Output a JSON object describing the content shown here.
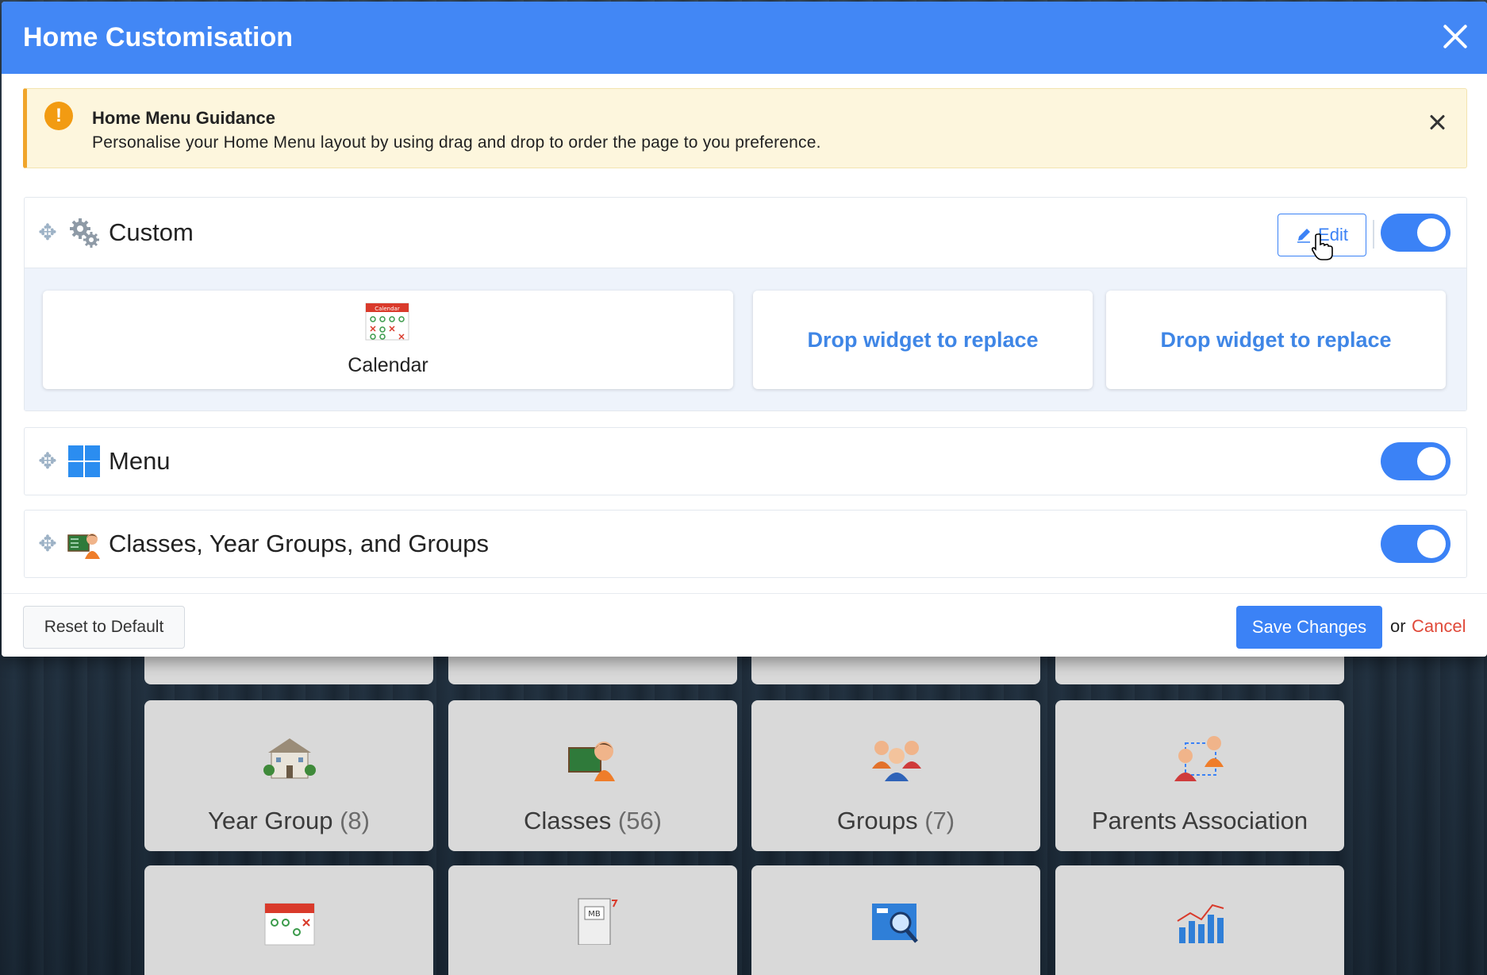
{
  "modal": {
    "title": "Home Customisation",
    "close_icon": "close-icon"
  },
  "alert": {
    "title": "Home Menu Guidance",
    "text": "Personalise your Home Menu layout by using drag and drop to order the page to you preference.",
    "icon": "!",
    "colors": {
      "background": "#fdf6dd",
      "accent": "#f0a52a"
    }
  },
  "sections": {
    "custom": {
      "label": "Custom",
      "icon": "gear-icon",
      "edit_label": "Edit",
      "enabled": true,
      "widgets": {
        "calendar": {
          "label": "Calendar",
          "icon_text": "Calendar"
        },
        "drop1": {
          "label": "Drop widget to replace"
        },
        "drop2": {
          "label": "Drop widget to replace"
        }
      }
    },
    "menu": {
      "label": "Menu",
      "icon": "windows-grid-icon",
      "enabled": true
    },
    "groups": {
      "label": "Classes, Year Groups, and Groups",
      "icon": "classroom-icon",
      "enabled": true
    }
  },
  "footer": {
    "reset_label": "Reset to Default",
    "save_label": "Save Changes",
    "or_text": "or",
    "cancel_label": "Cancel"
  },
  "background": {
    "tiles_row2": [
      {
        "name": "Year Group",
        "count": "(8)"
      },
      {
        "name": "Classes",
        "count": "(56)"
      },
      {
        "name": "Groups",
        "count": "(7)"
      },
      {
        "name": "Parents Association",
        "count": ""
      }
    ],
    "report_icon_text": "MB"
  },
  "colors": {
    "header": "#4287f5",
    "primary": "#3b82f6",
    "cancel": "#e04a3a"
  }
}
